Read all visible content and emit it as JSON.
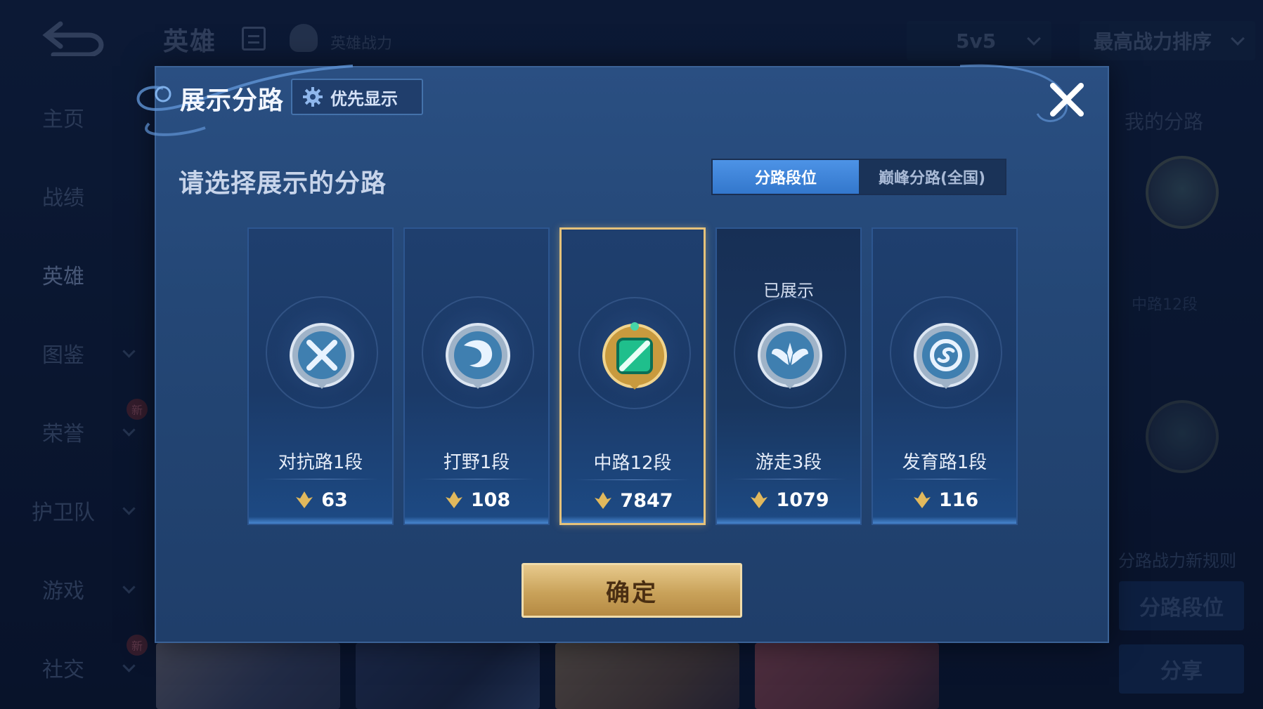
{
  "background": {
    "title": "英雄",
    "subtitle": "英雄战力",
    "mode_select": "5v5",
    "sort_select": "最高战力排序",
    "sidebar": [
      {
        "label": "主页"
      },
      {
        "label": "战绩"
      },
      {
        "label": "英雄"
      },
      {
        "label": "图鉴"
      },
      {
        "label": "荣誉",
        "badge": "新"
      },
      {
        "label": "护卫队"
      },
      {
        "label": "游戏"
      },
      {
        "label": "社交",
        "badge": "新"
      }
    ],
    "right_panel": {
      "title": "我的分路",
      "lane_label": "中路12段",
      "rules_link": "分路战力新规则",
      "lane_button": "分路段位",
      "share_button": "分享"
    }
  },
  "dialog": {
    "title": "展示分路",
    "priority_button": "优先显示",
    "subtitle": "请选择展示的分路",
    "tabs": [
      {
        "label": "分路段位",
        "selected": true
      },
      {
        "label": "巅峰分路(全国)",
        "selected": false
      }
    ],
    "lanes": [
      {
        "name": "对抗路1段",
        "points": "63",
        "icon": "clash-lane-emblem-icon",
        "selected": false,
        "shown_label": ""
      },
      {
        "name": "打野1段",
        "points": "108",
        "icon": "jungle-dragon-emblem-icon",
        "selected": false,
        "shown_label": ""
      },
      {
        "name": "中路12段",
        "points": "7847",
        "icon": "mid-lane-emblem-icon",
        "selected": true,
        "shown_label": ""
      },
      {
        "name": "游走3段",
        "points": "1079",
        "icon": "roam-wings-emblem-icon",
        "selected": false,
        "shown_label": "已展示"
      },
      {
        "name": "发育路1段",
        "points": "116",
        "icon": "farm-lane-emblem-icon",
        "selected": false,
        "shown_label": ""
      }
    ],
    "confirm_button": "确定"
  },
  "colors": {
    "accent_blue": "#3377cc",
    "gold_border": "#e5c27a",
    "confirm_gold": "#c9a25a"
  }
}
